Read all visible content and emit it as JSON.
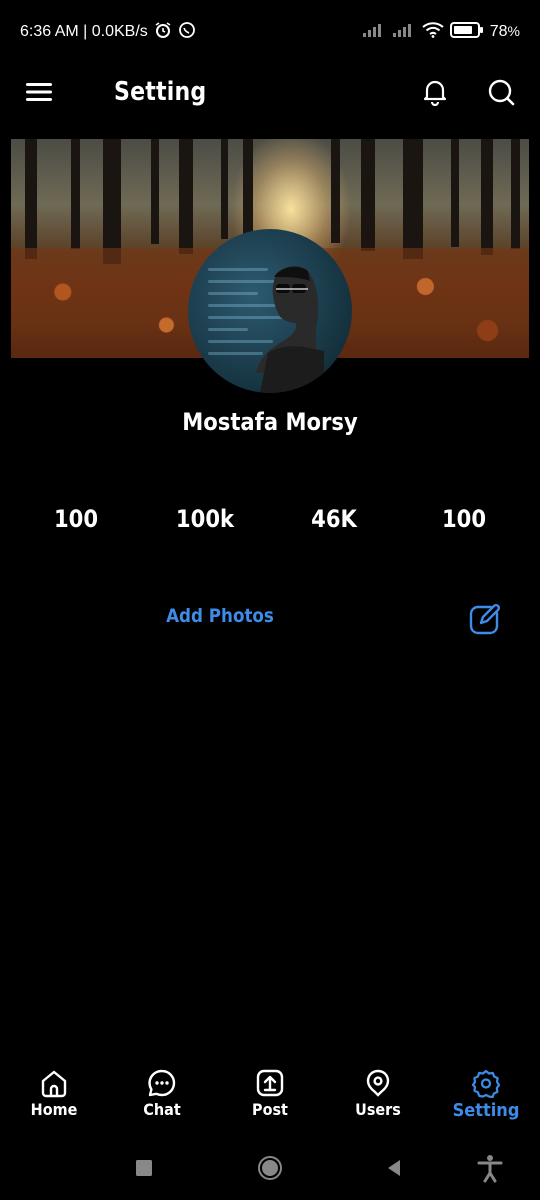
{
  "status_bar": {
    "time_speed": "6:36 AM | 0.0KB/s",
    "battery": "78",
    "battery_unit": "%"
  },
  "app_bar": {
    "title": "Setting"
  },
  "profile": {
    "name": "Mostafa Morsy"
  },
  "stats": [
    "100",
    "100k",
    "46K",
    "100"
  ],
  "actions": {
    "add_photos": "Add Photos"
  },
  "bottom_nav": {
    "items": [
      {
        "label": "Home",
        "icon": "home-icon"
      },
      {
        "label": "Chat",
        "icon": "chat-icon"
      },
      {
        "label": "Post",
        "icon": "post-icon"
      },
      {
        "label": "Users",
        "icon": "location-icon"
      },
      {
        "label": "Setting",
        "icon": "gear-icon"
      }
    ],
    "active": "Setting",
    "active_color": "#3d8ce8"
  }
}
